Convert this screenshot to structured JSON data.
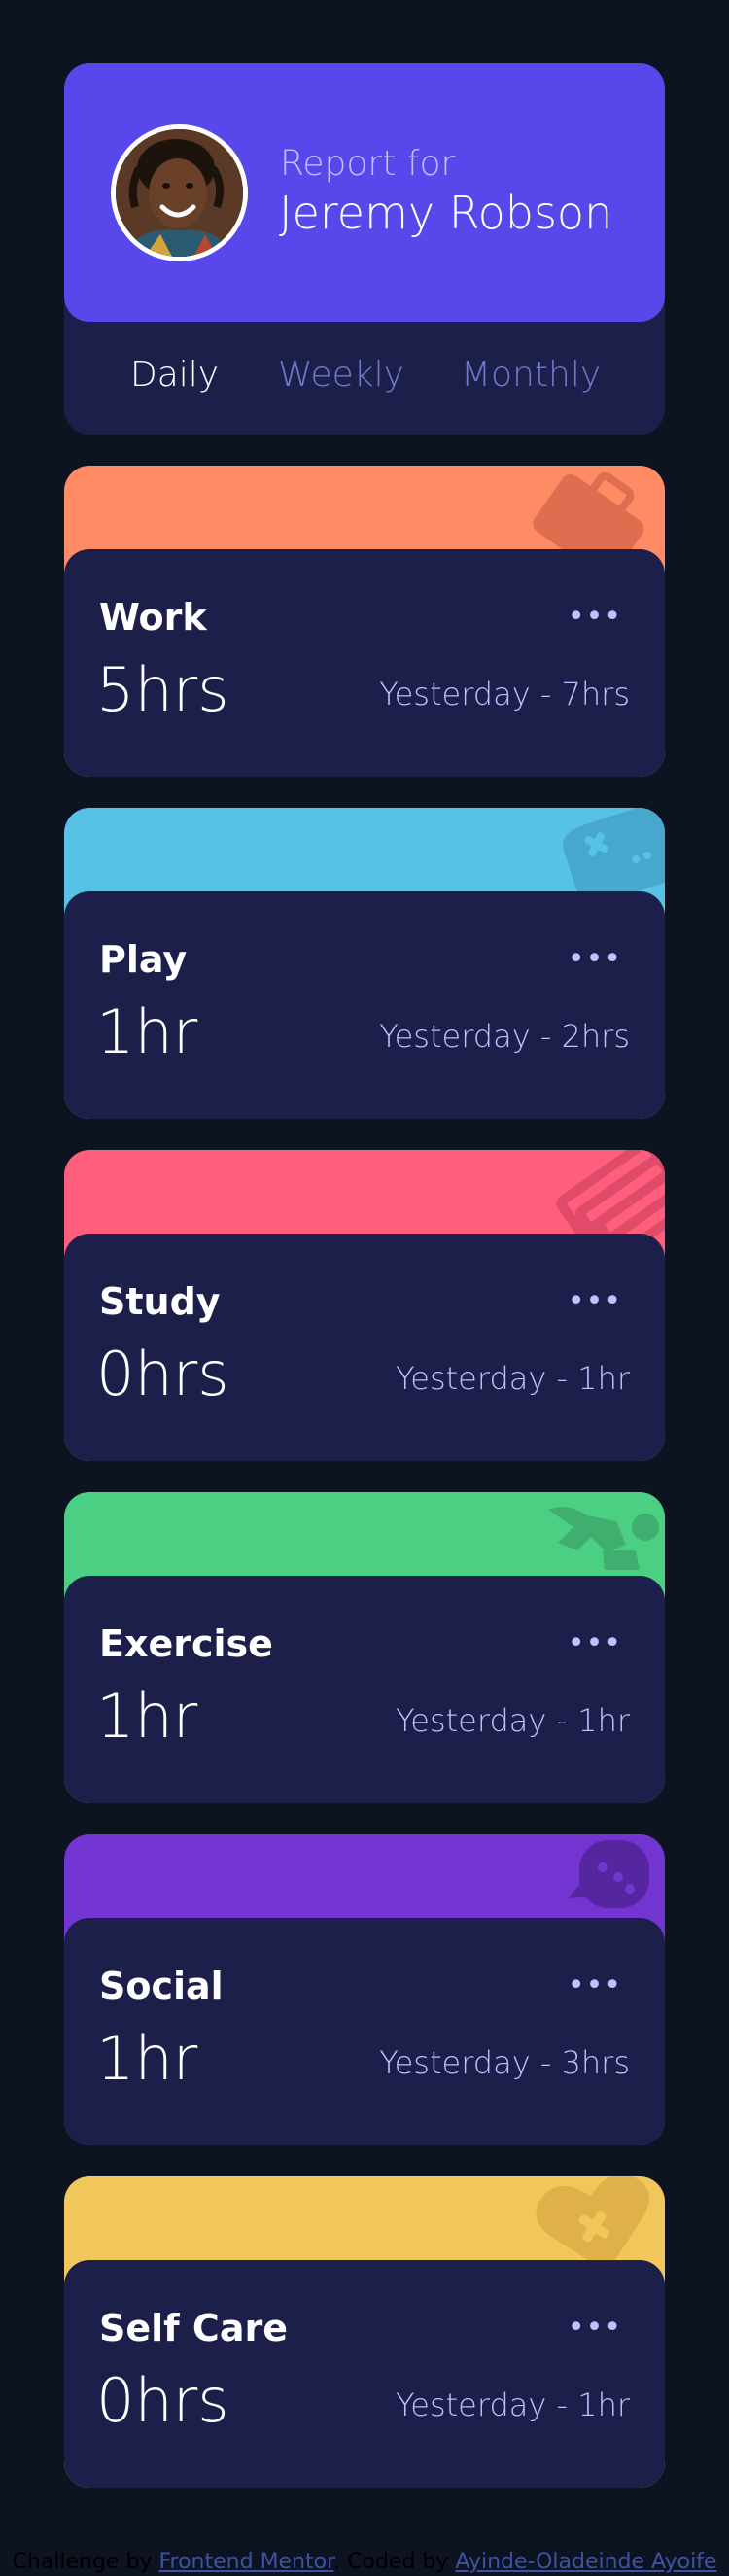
{
  "profile": {
    "label": "Report for",
    "name": "Jeremy Robson"
  },
  "periods": [
    {
      "label": "Daily",
      "active": true
    },
    {
      "label": "Weekly",
      "active": false
    },
    {
      "label": "Monthly",
      "active": false
    }
  ],
  "cards": [
    {
      "title": "Work",
      "current": "5hrs",
      "previous": "Yesterday - 7hrs",
      "color": "#ff8b64",
      "icon": "briefcase-icon"
    },
    {
      "title": "Play",
      "current": "1hr",
      "previous": "Yesterday - 2hrs",
      "color": "#56c2e6",
      "icon": "gamepad-icon"
    },
    {
      "title": "Study",
      "current": "0hrs",
      "previous": "Yesterday - 1hr",
      "color": "#ff5e7d",
      "icon": "books-icon"
    },
    {
      "title": "Exercise",
      "current": "1hr",
      "previous": "Yesterday - 1hr",
      "color": "#4bcf82",
      "icon": "running-icon"
    },
    {
      "title": "Social",
      "current": "1hr",
      "previous": "Yesterday - 3hrs",
      "color": "#7335d2",
      "icon": "chat-icon"
    },
    {
      "title": "Self Care",
      "current": "0hrs",
      "previous": "Yesterday - 1hr",
      "color": "#f1c75b",
      "icon": "heart-icon"
    }
  ],
  "menu_glyph": "•••",
  "attribution": {
    "prefix": "Challenge by ",
    "link1": "Frontend Mentor",
    "middle": ". Coded by ",
    "link2": "Ayinde-Oladeinde Ayoife"
  }
}
